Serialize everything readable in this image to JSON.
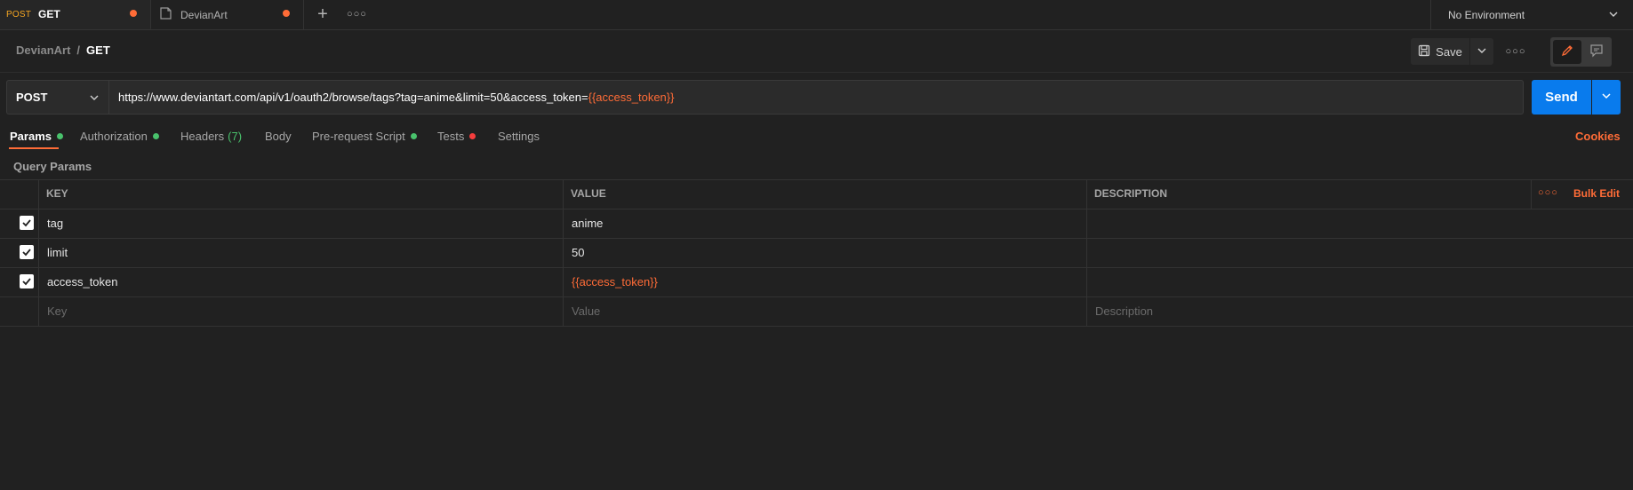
{
  "tabs": [
    {
      "method": "POST",
      "title": "GET"
    },
    {
      "title": "DevianArt"
    }
  ],
  "environment": "No Environment",
  "breadcrumb": {
    "parent": "DevianArt",
    "sep": "/",
    "current": "GET"
  },
  "toolbar": {
    "save_label": "Save"
  },
  "request": {
    "method": "POST",
    "url_base": "https://www.deviantart.com/api/v1/oauth2/browse/tags?tag=anime&limit=50&access_token=",
    "url_var": "{{access_token}}",
    "send_label": "Send"
  },
  "req_tabs": {
    "params": "Params",
    "authorization": "Authorization",
    "headers": "Headers",
    "headers_count": "(7)",
    "body": "Body",
    "prerequest": "Pre-request Script",
    "tests": "Tests",
    "settings": "Settings",
    "cookies": "Cookies"
  },
  "query_params": {
    "title": "Query Params",
    "headers": {
      "key": "KEY",
      "value": "VALUE",
      "description": "DESCRIPTION",
      "bulk_edit": "Bulk Edit"
    },
    "rows": [
      {
        "key": "tag",
        "value": "anime"
      },
      {
        "key": "limit",
        "value": "50"
      },
      {
        "key": "access_token",
        "value": "{{access_token}}"
      }
    ],
    "placeholders": {
      "key": "Key",
      "value": "Value",
      "description": "Description"
    }
  },
  "colors": {
    "accent": "#ff6c37",
    "send": "#097bed",
    "ok": "#49c26c",
    "error": "#f53d3d"
  }
}
